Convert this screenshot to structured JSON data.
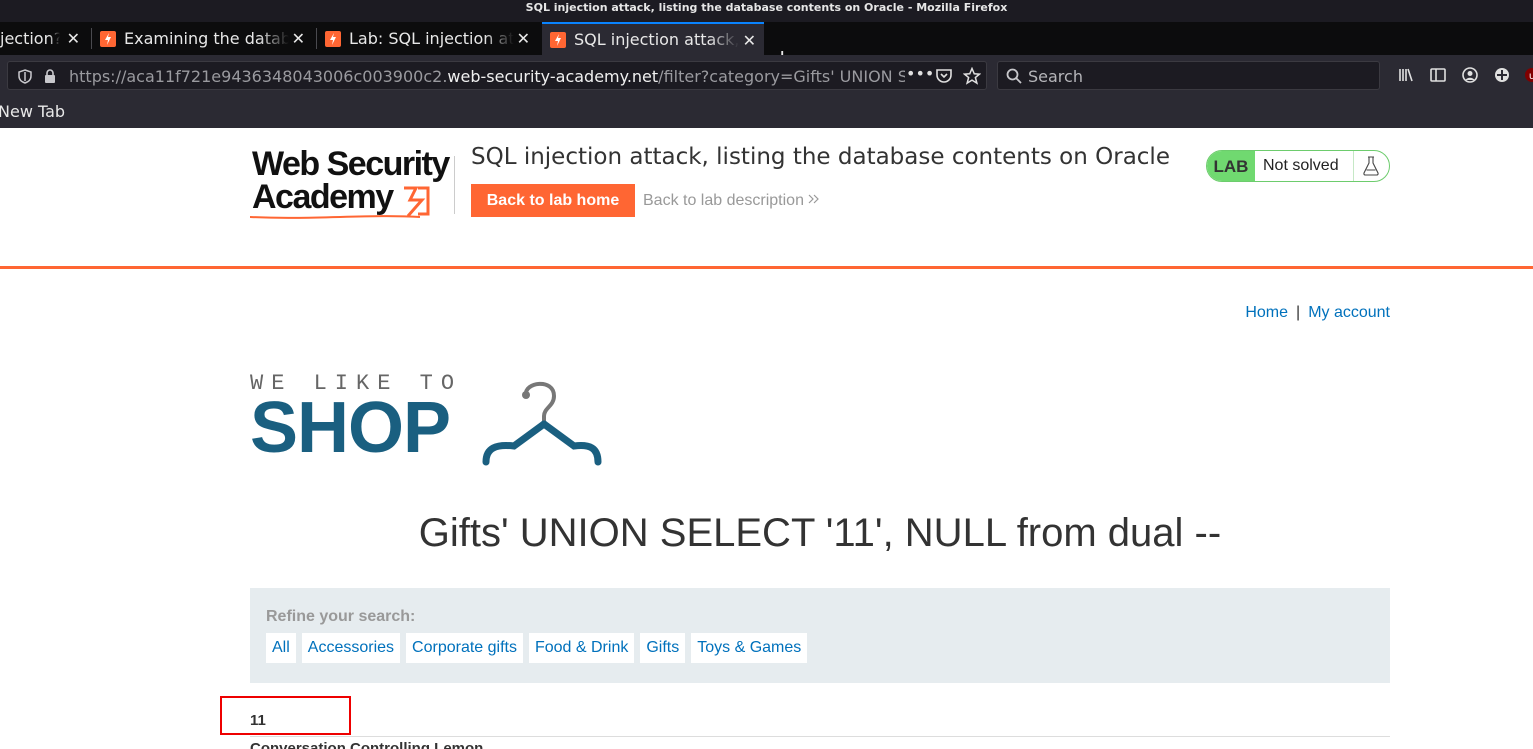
{
  "window": {
    "title": "SQL injection attack, listing the database contents on Oracle - Mozilla Firefox"
  },
  "tabs": [
    {
      "label": "jection?",
      "active": false
    },
    {
      "label": "Examining the database",
      "active": false
    },
    {
      "label": "Lab: SQL injection attack",
      "active": false
    },
    {
      "label": "SQL injection attack, listing",
      "active": true
    }
  ],
  "toolbar": {
    "url_prefix": "https://aca11f721e9436348043006c003900c2.",
    "url_host": "web-security-academy.net",
    "url_path": "/filter?category=Gifts' UNION SELECT",
    "search_placeholder": "Search"
  },
  "bookmarks": {
    "new_tab": "New Tab"
  },
  "lab": {
    "logo_line1": "Web Security",
    "logo_line2": "Academy",
    "title": "SQL injection attack, listing the database contents on Oracle",
    "back_home": "Back to lab home",
    "back_description": "Back to lab description",
    "badge": "LAB",
    "status": "Not solved"
  },
  "nav": {
    "home": "Home",
    "separator": "|",
    "account": "My account"
  },
  "shop": {
    "tagline": "WE LIKE TO",
    "word": "SHOP"
  },
  "main": {
    "heading": "Gifts' UNION SELECT '11', NULL from dual --",
    "refine_label": "Refine your search:",
    "filters": [
      "All",
      "Accessories",
      "Corporate gifts",
      "Food & Drink",
      "Gifts",
      "Toys & Games"
    ],
    "result_value": "11",
    "next_product": "Conversation Controlling Lemon"
  },
  "colors": {
    "accent": "#ff6633",
    "link": "#0071bc",
    "shop_blue": "#1a5f80",
    "lab_green": "#70d970",
    "highlight": "#ee0000"
  }
}
